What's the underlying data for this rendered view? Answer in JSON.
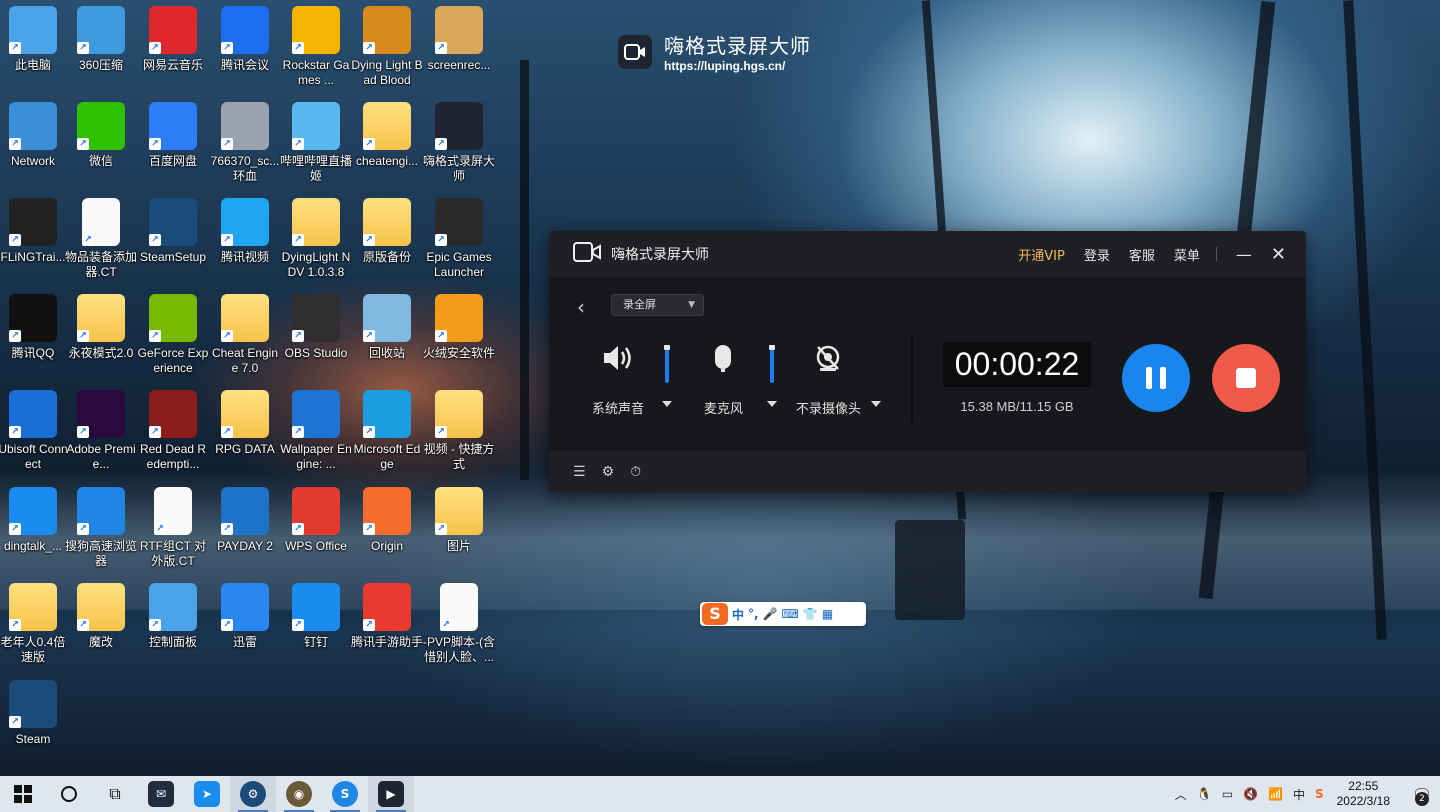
{
  "desktop": {
    "icons": [
      {
        "label": "此电脑",
        "icon": "computer-icon",
        "color": "#4aa3e8"
      },
      {
        "label": "360压缩",
        "icon": "zip-icon",
        "color": "#3f9be0"
      },
      {
        "label": "网易云音乐",
        "icon": "netease-music-icon",
        "color": "#e0272b"
      },
      {
        "label": "腾讯会议",
        "icon": "tencent-meeting-icon",
        "color": "#1c6ff2"
      },
      {
        "label": "Rockstar Games ...",
        "icon": "rockstar-icon",
        "color": "#f6b400"
      },
      {
        "label": "Dying Light Bad Blood",
        "icon": "dying-light-icon",
        "color": "#d88a1c"
      },
      {
        "label": "screenrec...",
        "icon": "screenrec-icon",
        "color": "#d9a65a"
      },
      {
        "label": "Network",
        "icon": "network-icon",
        "color": "#3a8fd8"
      },
      {
        "label": "微信",
        "icon": "wechat-icon",
        "color": "#2dc100"
      },
      {
        "label": "百度网盘",
        "icon": "baidu-netdisk-icon",
        "color": "#2b7ef5"
      },
      {
        "label": "766370_sc... 环血",
        "icon": "image-file-icon",
        "color": "#9aa3ad"
      },
      {
        "label": "哔哩哔哩直播姬",
        "icon": "bilibili-live-icon",
        "color": "#5ab8f0"
      },
      {
        "label": "cheatengi...",
        "icon": "folder-icon",
        "color": "#f6c34b"
      },
      {
        "label": "嗨格式录屏大师",
        "icon": "hgs-recorder-icon",
        "color": "#1f2430"
      },
      {
        "label": "FLiNGTrai...",
        "icon": "fling-trainer-icon",
        "color": "#222222"
      },
      {
        "label": "物品装备添加器.CT",
        "icon": "document-icon",
        "color": "#fafafa"
      },
      {
        "label": "SteamSetup",
        "icon": "steam-icon",
        "color": "#1b4c79"
      },
      {
        "label": "腾讯视频",
        "icon": "tencent-video-icon",
        "color": "#20a6f0"
      },
      {
        "label": "DyingLight NDV 1.0.3.8",
        "icon": "folder-icon",
        "color": "#f6c34b"
      },
      {
        "label": "原版备份",
        "icon": "folder-icon",
        "color": "#f6c34b"
      },
      {
        "label": "Epic Games Launcher",
        "icon": "epic-games-icon",
        "color": "#2a2a2a"
      },
      {
        "label": "腾讯QQ",
        "icon": "qq-icon",
        "color": "#111111"
      },
      {
        "label": "永夜模式2.0",
        "icon": "folder-icon",
        "color": "#f6c34b"
      },
      {
        "label": "GeForce Experience",
        "icon": "geforce-icon",
        "color": "#76b900"
      },
      {
        "label": "Cheat Engine 7.0",
        "icon": "folder-icon",
        "color": "#f6c34b"
      },
      {
        "label": "OBS Studio",
        "icon": "obs-icon",
        "color": "#302e31"
      },
      {
        "label": "回收站",
        "icon": "recycle-bin-icon",
        "color": "#7fb8e0"
      },
      {
        "label": "火绒安全软件",
        "icon": "huorong-icon",
        "color": "#f39c1c"
      },
      {
        "label": "Ubisoft Connect",
        "icon": "ubisoft-icon",
        "color": "#1a6fd6"
      },
      {
        "label": "Adobe Premie...",
        "icon": "premiere-icon",
        "color": "#2a0a3e"
      },
      {
        "label": "Red Dead Redempti...",
        "icon": "rdr-icon",
        "color": "#8b1d1d"
      },
      {
        "label": "RPG DATA",
        "icon": "folder-icon",
        "color": "#f6c34b"
      },
      {
        "label": "Wallpaper Engine: ...",
        "icon": "wallpaper-engine-icon",
        "color": "#1e74d6"
      },
      {
        "label": "Microsoft Edge",
        "icon": "edge-icon",
        "color": "#1b9de2"
      },
      {
        "label": "视频 - 快捷方式",
        "icon": "folder-icon",
        "color": "#f6c34b"
      },
      {
        "label": "dingtalk_...",
        "icon": "dingtalk-icon",
        "color": "#1a8cf0"
      },
      {
        "label": "搜狗高速浏览器",
        "icon": "sogou-browser-icon",
        "color": "#1f86e6"
      },
      {
        "label": "RTF组CT 对外版.CT",
        "icon": "document-icon",
        "color": "#fafafa"
      },
      {
        "label": "PAYDAY 2",
        "icon": "payday-icon",
        "color": "#1e73c8"
      },
      {
        "label": "WPS Office",
        "icon": "wps-icon",
        "color": "#e23a2f"
      },
      {
        "label": "Origin",
        "icon": "origin-icon",
        "color": "#f56c2d"
      },
      {
        "label": "图片",
        "icon": "folder-icon",
        "color": "#f6c34b"
      },
      {
        "label": "老年人0.4倍速版",
        "icon": "folder-icon",
        "color": "#f6c34b"
      },
      {
        "label": "魔改",
        "icon": "folder-icon",
        "color": "#f6c34b"
      },
      {
        "label": "控制面板",
        "icon": "control-panel-icon",
        "color": "#4aa3e8"
      },
      {
        "label": "迅雷",
        "icon": "thunder-icon",
        "color": "#2a86f0"
      },
      {
        "label": "钉钉",
        "icon": "dingtalk-icon",
        "color": "#1a8cf0"
      },
      {
        "label": "腾讯手游助手",
        "icon": "tencent-mobile-game-icon",
        "color": "#e83a2e"
      },
      {
        "label": "-PVP脚本-(含惜别人脸、...",
        "icon": "document-icon",
        "color": "#fafafa"
      },
      {
        "label": "Steam",
        "icon": "steam-icon",
        "color": "#1b4c79"
      }
    ]
  },
  "watermark": {
    "title": "嗨格式录屏大师",
    "url": "https://luping.hgs.cn/"
  },
  "recorder": {
    "title": "嗨格式录屏大师",
    "menu": {
      "vip": "开通VIP",
      "login": "登录",
      "service": "客服",
      "menu": "菜单"
    },
    "mode": "录全屏",
    "system_audio_label": "系统声音",
    "system_audio_level": 1.0,
    "mic_label": "麦克风",
    "mic_level": 1.0,
    "camera_label": "不录摄像头",
    "timer": "00:00:22",
    "file_size": "15.38 MB/11.15 GB",
    "colors": {
      "accent": "#1a84ef",
      "stop": "#f05a4a",
      "vip": "#f2b75c"
    }
  },
  "ime": {
    "logo": "S",
    "mode": "中",
    "punct": "°,"
  },
  "taskbar": {
    "time": "22:55",
    "date": "2022/3/18",
    "notification_count": "2",
    "tray_lang": "中"
  }
}
